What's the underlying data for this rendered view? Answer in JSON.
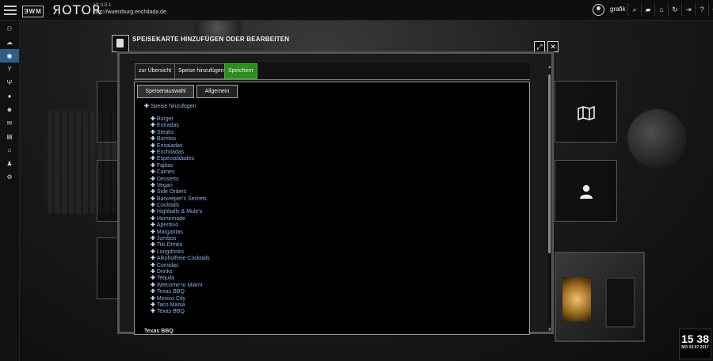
{
  "app": {
    "brand": "ЯOTOR",
    "logo_text": "ƎWM",
    "version": "V1.0.5.1",
    "url": "http://wuerzburg.enchilada.de"
  },
  "header": {
    "username": "grafik"
  },
  "sidebar": {
    "items": [
      "users-icon",
      "cloud-icon",
      "globe-icon",
      "cocktail-icon",
      "cutlery-icon",
      "location-icon",
      "group-icon",
      "mail-icon",
      "list-icon",
      "home-icon",
      "person-icon",
      "settings-icon"
    ]
  },
  "dialog": {
    "title": "SPEISEKARTE HINZUFÜGEN ODER BEARBEITEN",
    "tabs": {
      "overview": "zur Übersicht",
      "add": "Speise hinzufügen",
      "save": "Speichern"
    },
    "subtabs": {
      "selection": "Speisenauswahl",
      "general": "Allgemein"
    },
    "add_dish": "Speise hinzufügen",
    "categories": [
      "Burger",
      "Entradas",
      "Steaks",
      "Burritos",
      "Ensaladas",
      "Enchiladas",
      "Especialidades",
      "Fajitas",
      "Carnes",
      "Desserts",
      "Vegan",
      "Side Orders",
      "Barkeeper's Secrets",
      "Cocktails",
      "Highballs & Mule's",
      "Homemade",
      "Aperitivo",
      "Margaritas",
      "Jumbos",
      "Tiki Drinks",
      "Longdrinks",
      "Alkoholfreie Cocktails",
      "Comidas",
      "Drinks",
      "Tequila",
      "Welcome to Miami",
      "Texas BBQ",
      "Mexico City",
      "Taco Mania",
      "Texas BBQ"
    ],
    "section_heading": "Texas BBQ"
  },
  "clock": {
    "time": "15 38",
    "date": "MO 03.07.2017"
  }
}
